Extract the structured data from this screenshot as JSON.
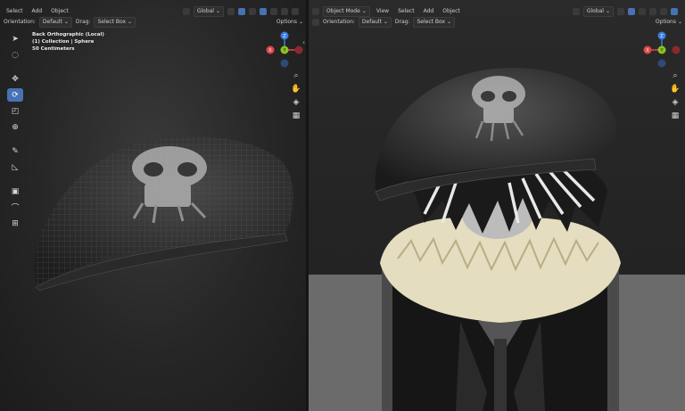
{
  "left_viewport": {
    "header": {
      "menus": [
        "Select",
        "Add",
        "Object"
      ],
      "transform_space": "Global",
      "orientation_label": "Orientation:",
      "orientation_value": "Default",
      "drag_label": "Drag:",
      "drag_value": "Select Box",
      "options_label": "Options"
    },
    "overlay": {
      "view_name": "Back Orthographic (Local)",
      "collection": "(1) Collection | Sphere",
      "scale": "50 Centimeters"
    },
    "tools": [
      "tweak-icon",
      "select-circle-icon",
      "move-icon",
      "rotate-icon",
      "scale-icon",
      "transform-icon",
      "annotate-icon",
      "measure-icon",
      "add-cube-icon",
      "spin-icon",
      "shrink-icon"
    ],
    "active_tool": "rotate-icon",
    "gizmo": {
      "x_label": "X",
      "y_label": "Y",
      "z_label": "Z"
    }
  },
  "right_viewport": {
    "header": {
      "mode": "Object Mode",
      "menus": [
        "View",
        "Select",
        "Add",
        "Object"
      ],
      "transform_space": "Global",
      "orientation_label": "Orientation:",
      "orientation_value": "Default",
      "drag_label": "Drag:",
      "drag_value": "Select Box",
      "options_label": "Options"
    },
    "gizmo": {
      "x_label": "X",
      "y_label": "Y",
      "z_label": "Z"
    }
  },
  "colors": {
    "accent": "#4772b3",
    "axis_x": "#e2464a",
    "axis_y": "#8ac51f",
    "axis_z": "#3b7ddd"
  }
}
